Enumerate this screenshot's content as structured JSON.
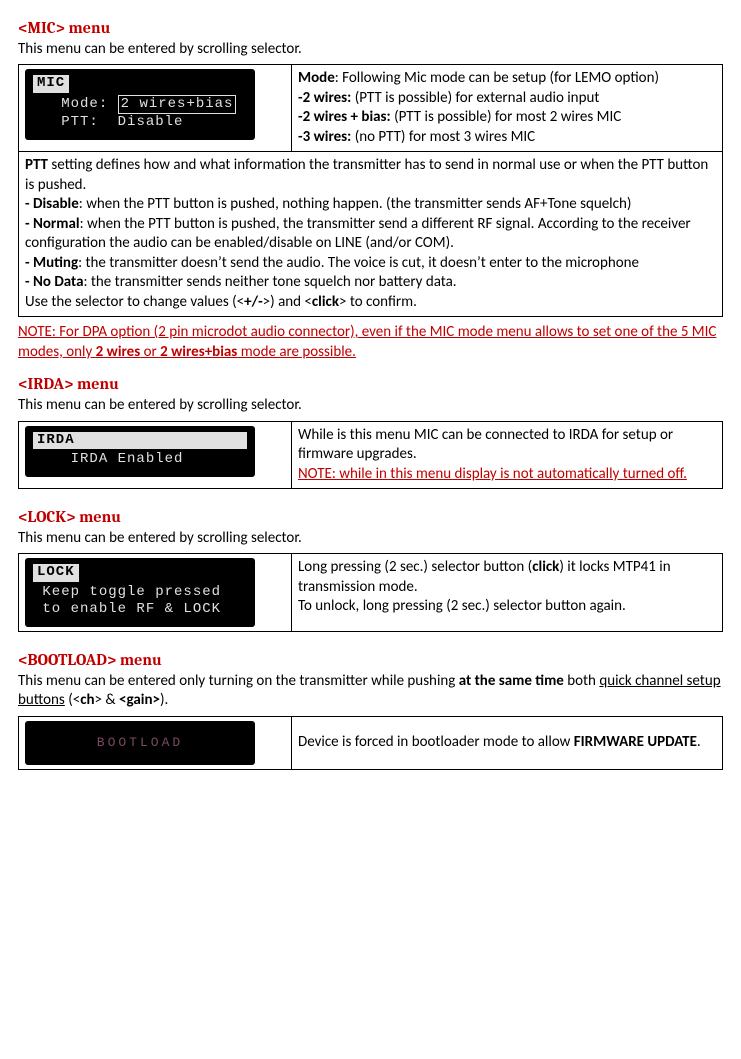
{
  "mic": {
    "heading": "<MIC> menu",
    "intro": "This menu can be entered by scrolling selector.",
    "lcd": {
      "title": "MIC",
      "row1_label": "Mode:",
      "row1_value": "2 wires+bias",
      "row2_label": "PTT:",
      "row2_value": "Disable"
    },
    "mode_lead": "Mode",
    "mode_lead_rest": ": Following Mic mode can be setup (for LEMO option)",
    "opt1_b": "-2 wires:",
    "opt1_rest": " (PTT is possible) for external audio input",
    "opt2_b": "-2 wires + bias:",
    "opt2_rest": " (PTT is possible) for most 2 wires MIC",
    "opt3_b": "-3 wires:",
    "opt3_rest": " (no PTT) for most 3 wires MIC",
    "ptt_b": "PTT",
    "ptt_rest": " setting defines how and what information the transmitter has to send in normal use or when the PTT button is pushed.",
    "disable_b": "- Disable",
    "disable_rest": ": when the PTT button is pushed, nothing happen. (the transmitter sends AF+Tone squelch)",
    "normal_b": "- Normal",
    "normal_rest": ": when the PTT button is pushed, the transmitter send a different RF signal. According to the receiver configuration the audio can be enabled/disable on LINE (and/or COM).",
    "muting_b": "- Muting",
    "muting_rest": ": the transmitter doesn’t send the audio. The voice is cut, it doesn’t enter to the microphone",
    "nodata_b": "- No Data",
    "nodata_rest": ": the transmitter sends neither tone squelch nor battery data.",
    "sel_pre": "Use the selector to change values (<",
    "sel_b1": "+/-",
    "sel_mid": ">) and <",
    "sel_b2": "click",
    "sel_post": "> to confirm.",
    "note_pre": "NOTE: For DPA option (2 pin microdot audio connector), even if the MIC mode menu allows to set one of the 5 MIC modes, only ",
    "note_b1": "2 wires",
    "note_mid": " or ",
    "note_b2": "2 wires+bias",
    "note_post": " mode are possible."
  },
  "irda": {
    "heading": "<IRDA> menu",
    "intro": "This menu can be entered by scrolling selector.",
    "lcd": {
      "title": "IRDA",
      "row1": "IRDA Enabled"
    },
    "desc": "While is this menu MIC can be connected to IRDA for setup or firmware upgrades.",
    "note": "NOTE: while in this menu display is not automatically turned off."
  },
  "lock": {
    "heading": "<LOCK> menu",
    "intro": "This menu can be entered by scrolling selector.",
    "lcd": {
      "title": "LOCK",
      "row1": "Keep toggle pressed",
      "row2": "to enable RF & LOCK"
    },
    "p1_pre": "Long pressing (2 sec.) selector button (",
    "p1_b": "click",
    "p1_post": ") it locks MTP41 in transmission mode.",
    "p2": "To unlock, long pressing (2 sec.) selector button again."
  },
  "bootload": {
    "heading": "<BOOTLOAD> menu",
    "intro_pre": "This menu can be entered only turning on the transmitter while pushing ",
    "intro_b1": "at the same time",
    "intro_mid": " both ",
    "intro_u": "quick channel setup buttons",
    "intro_paren_pre": " (<",
    "intro_b2": "ch",
    "intro_amp": "> & ",
    "intro_b3": "<gain>",
    "intro_paren_post": ").",
    "lcd": {
      "text": "BOOTLOAD"
    },
    "desc_pre": "Device is forced in bootloader mode to allow ",
    "desc_b": "FIRMWARE UPDATE",
    "desc_post": "."
  }
}
